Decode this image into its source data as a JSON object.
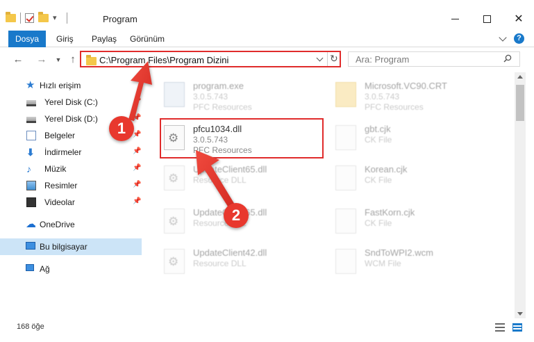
{
  "window": {
    "title": "Program"
  },
  "ribbon": {
    "tabs": [
      "Dosya",
      "Giriş",
      "Paylaş",
      "Görünüm"
    ],
    "help_label": "?"
  },
  "navigation": {
    "address_path": "C:\\Program Files\\Program Dizini",
    "search_placeholder": "Ara: Program"
  },
  "sidebar": {
    "items": [
      {
        "label": "Hızlı erişim",
        "icon": "star-icon"
      },
      {
        "label": "Yerel Disk (C:)",
        "icon": "drive-icon"
      },
      {
        "label": "Yerel Disk (D:)",
        "icon": "drive-icon"
      },
      {
        "label": "Belgeler",
        "icon": "documents-icon"
      },
      {
        "label": "İndirmeler",
        "icon": "download-icon"
      },
      {
        "label": "Müzik",
        "icon": "music-icon"
      },
      {
        "label": "Resimler",
        "icon": "pictures-icon"
      },
      {
        "label": "Videolar",
        "icon": "videos-icon"
      },
      {
        "label": "OneDrive",
        "icon": "cloud-icon"
      },
      {
        "label": "Bu bilgisayar",
        "icon": "computer-icon"
      },
      {
        "label": "Ağ",
        "icon": "network-icon"
      }
    ]
  },
  "files": [
    {
      "name": "program.exe",
      "line1": "3.0.5.743",
      "line2": "PFC Resources"
    },
    {
      "name": "Microsoft.VC90.CRT",
      "line1": "3.0.5.743",
      "line2": "PFC Resources"
    },
    {
      "name": "pfcu1034.dll",
      "line1": "3.0.5.743",
      "line2": "PFC Resources"
    },
    {
      "name": "gbt.cjk",
      "line1": "CK File",
      "line2": ""
    },
    {
      "name": "UpdateClient65.dll",
      "line1": "Resource DLL",
      "line2": ""
    },
    {
      "name": "Korean.cjk",
      "line1": "CK File",
      "line2": ""
    },
    {
      "name": "UpdateClient65.dll",
      "line1": "Resource DLL",
      "line2": ""
    },
    {
      "name": "FastKorn.cjk",
      "line1": "CK File",
      "line2": ""
    },
    {
      "name": "UpdateClient42.dll",
      "line1": "Resource DLL",
      "line2": ""
    },
    {
      "name": "SndToWPI2.wcm",
      "line1": "WCM File",
      "line2": ""
    }
  ],
  "status": {
    "item_count": "168 öğe"
  },
  "annotations": {
    "step1": "1",
    "step2": "2",
    "accent_color": "#e02b2b"
  }
}
